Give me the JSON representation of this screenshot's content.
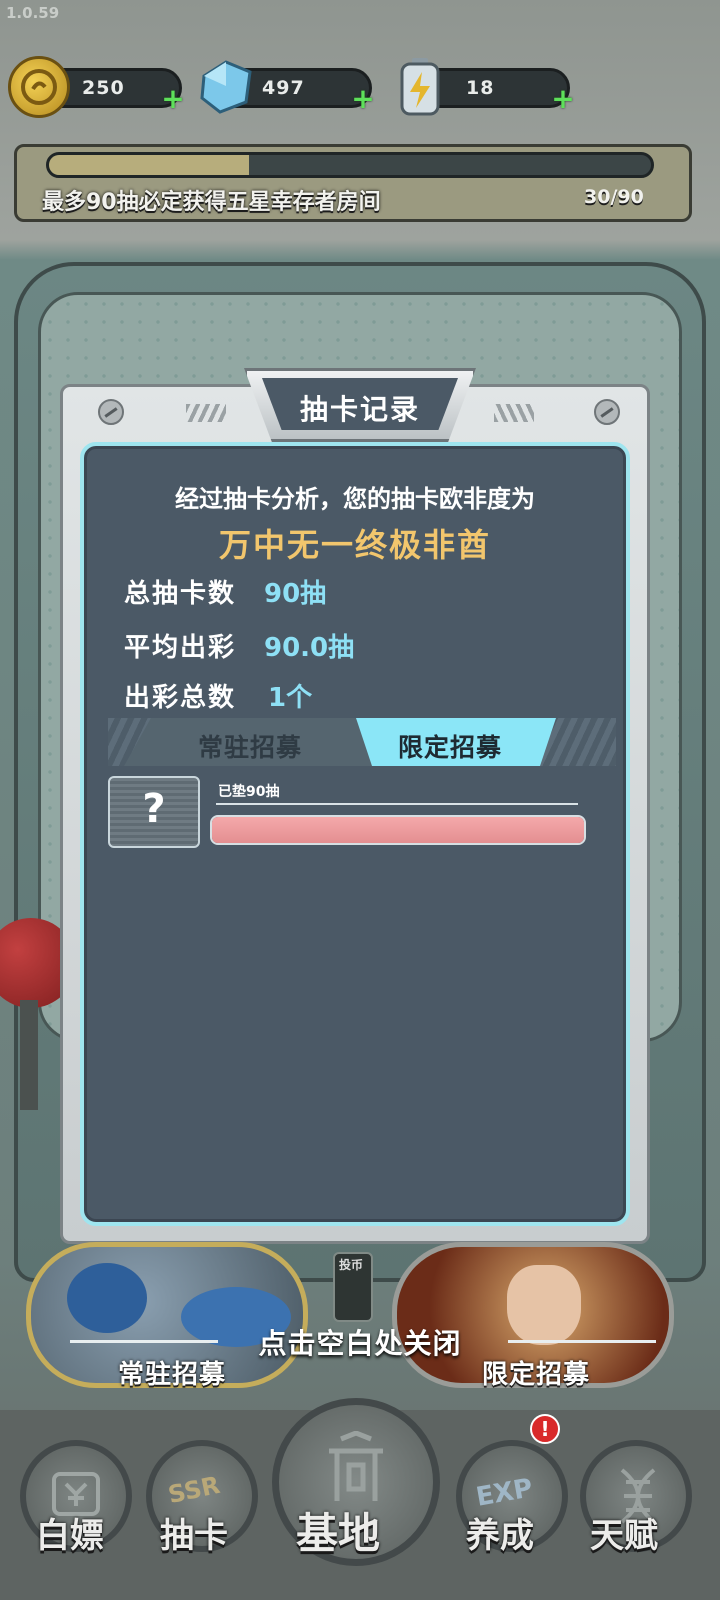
{
  "app": {
    "version": "1.0.59"
  },
  "resources": [
    {
      "name": "coin",
      "icon": "coin-icon",
      "value": "250",
      "color": "#d9b43a"
    },
    {
      "name": "diamond",
      "icon": "diamond-icon",
      "value": "497",
      "color": "#6ec6e8"
    },
    {
      "name": "energy",
      "icon": "battery-energy-icon",
      "value": "18",
      "color": "#c9d8e0"
    }
  ],
  "pity_progress": {
    "text": "最多90抽必定获得五星幸存者房间",
    "count": "30/90",
    "fraction": 0.333
  },
  "dialog": {
    "title": "抽卡记录",
    "intro": "经过抽卡分析，您的抽卡欧非度为",
    "rating": "万中无一终极非酋",
    "stats": [
      {
        "label": "总抽卡数",
        "value": "90抽"
      },
      {
        "label": "平均出彩",
        "value": "90.0抽"
      },
      {
        "label": "出彩总数",
        "value": "1个"
      }
    ],
    "tabs": [
      {
        "label": "常驻招募",
        "active": false
      },
      {
        "label": "限定招募",
        "active": true
      }
    ],
    "record": {
      "icon_text": "?",
      "label": "已垫90抽",
      "fill_fraction": 1.0,
      "bar_color": "#ef9a9b"
    }
  },
  "close_hint": "点击空白处关闭",
  "pools": [
    {
      "label": "常驻招募"
    },
    {
      "label": "限定招募"
    }
  ],
  "coin_slot_label": "投币",
  "nav": [
    {
      "label": "白嫖",
      "icon": "ticket-icon"
    },
    {
      "label": "抽卡",
      "icon": "ssr-icon"
    },
    {
      "label": "基地",
      "icon": "base-icon"
    },
    {
      "label": "养成",
      "icon": "exp-icon",
      "badge": "!"
    },
    {
      "label": "天赋",
      "icon": "dna-icon"
    }
  ],
  "colors": {
    "accent_cyan": "#8ee0f5",
    "rating_gold": "#f2c66d",
    "panel": "#4b5966"
  }
}
